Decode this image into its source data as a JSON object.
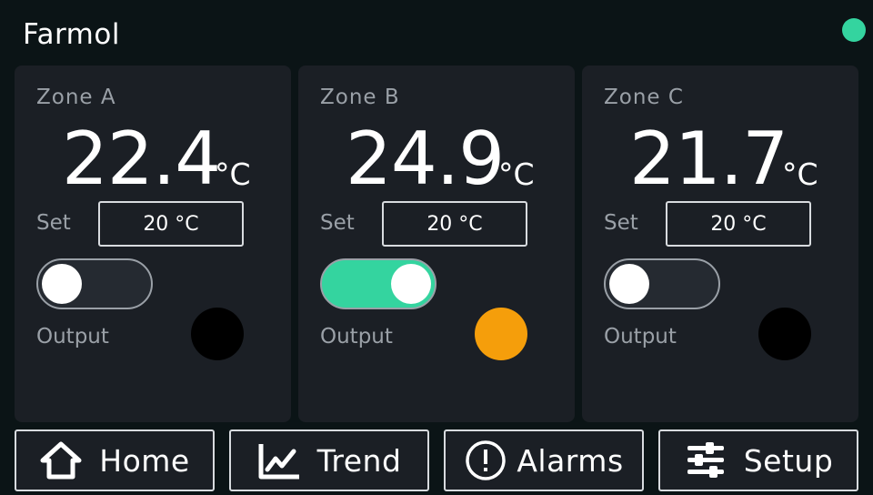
{
  "app": {
    "title": "Farmol"
  },
  "status": {
    "color": "#34d49f"
  },
  "zones": [
    {
      "label": "Zone A",
      "temperature": "22.4",
      "unit": "°C",
      "set_label": "Set",
      "setpoint": "20 °C",
      "output_on": false,
      "output_label": "Output",
      "led_color": "#000000"
    },
    {
      "label": "Zone B",
      "temperature": "24.9",
      "unit": "°C",
      "set_label": "Set",
      "setpoint": "20 °C",
      "output_on": true,
      "output_label": "Output",
      "led_color": "#f59e0b"
    },
    {
      "label": "Zone C",
      "temperature": "21.7",
      "unit": "°C",
      "set_label": "Set",
      "setpoint": "20 °C",
      "output_on": false,
      "output_label": "Output",
      "led_color": "#000000"
    }
  ],
  "nav": {
    "home": {
      "label": "Home",
      "icon": "home-icon"
    },
    "trend": {
      "label": "Trend",
      "icon": "trend-icon"
    },
    "alarms": {
      "label": "Alarms",
      "icon": "alert-icon"
    },
    "setup": {
      "label": "Setup",
      "icon": "sliders-icon"
    }
  },
  "colors": {
    "accent": "#34d49f",
    "warning": "#f59e0b",
    "card": "#1b1f25",
    "background": "#0b1416"
  }
}
